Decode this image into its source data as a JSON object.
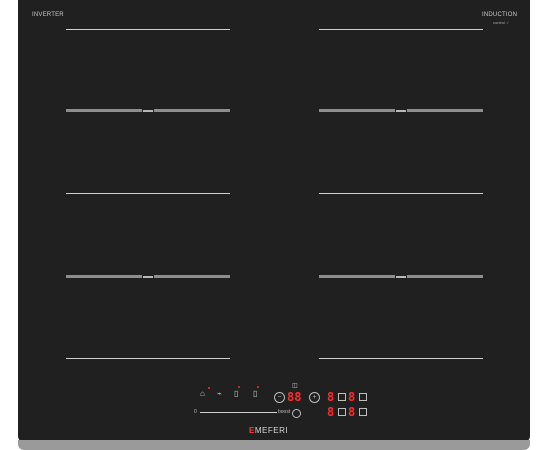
{
  "labels": {
    "inverter": "INVERTER",
    "induction": "INDUCTION",
    "induction_sub": "control ✓",
    "brand_e": "E",
    "brand_rest": "MEFERI",
    "slider_min": "0",
    "slider_max": "boost"
  },
  "display": {
    "center": "88",
    "zones": [
      "8",
      "8",
      "8",
      "8"
    ]
  },
  "colors": {
    "surface": "#202020",
    "accent": "#ff2a2a",
    "lines": "#cfcfcf"
  },
  "icons": {
    "lock": "lock-icon",
    "wifi": "wifi-icon",
    "bridge_left": "bridge-icon",
    "bridge_right": "bridge-icon",
    "timer": "timer-icon",
    "minus": "minus-icon",
    "plus": "plus-icon",
    "power": "power-icon"
  }
}
